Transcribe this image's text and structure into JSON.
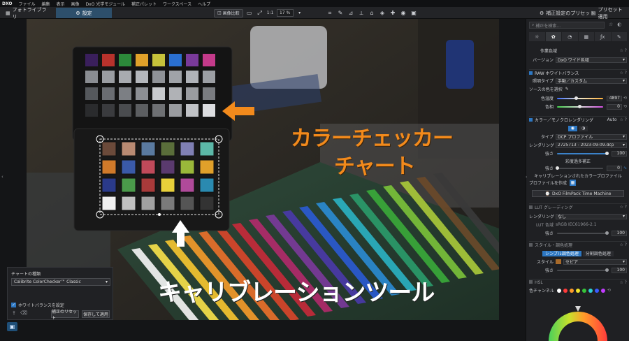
{
  "menu": {
    "logo": "DXO",
    "items": [
      "ファイル",
      "編集",
      "表示",
      "画像",
      "DxO 光学モジュール",
      "補正パレット",
      "ワークスペース",
      "ヘルプ"
    ]
  },
  "toolbar": {
    "library_tab": "フォトライブラリ",
    "settings_tab": "設定",
    "compare_label": "画像比較",
    "zoom_ratio": "1:1",
    "zoom_percent": "17 %",
    "presets_label": "補正設定のプリセット",
    "preview_label": "プリセット適用"
  },
  "overlay": {
    "line1": "カラーチェッカー",
    "line2": "チャート",
    "line3": "キャリブレーションツール"
  },
  "chart_panel": {
    "title": "チャートの種類",
    "selected": "Calibrite ColorChecker™ Classic",
    "whitebalance_label": "ホワイトバランスを設定",
    "reset_label": "補正のリセット",
    "save_label": "保存して適用"
  },
  "right_panel": {
    "search_placeholder": "補正を検索...",
    "working_color": {
      "title": "作業色域",
      "version_label": "バージョン",
      "version_value": "DxO ワイド色域"
    },
    "raw_wb": {
      "title": "RAW ホワイトバランス",
      "light_type_label": "照明タイプ",
      "light_type_value": "手動／カスタム",
      "picker_label": "ソースの色を選択",
      "temp_label": "色温度",
      "temp_value": "4897",
      "tint_label": "色相",
      "tint_value": "0"
    },
    "color_render": {
      "title": "カラー／モノクロレンダリング",
      "auto_label": "Auto",
      "type_label": "タイプ",
      "type_value": "DCP プロファイル",
      "rendering_label": "レンダリング",
      "rendering_value": "2725713 - 2023-09-09.dcp",
      "strength_label": "強さ",
      "strength_value": "100",
      "protect_label": "彩度過多補正",
      "protect_strength_label": "強さ",
      "protect_strength_value": "0",
      "calibrated_label": "キャリブレーションされたカラープロファイル",
      "create_profile_label": "プロファイルを作成",
      "filmpack_label": "DxO FilmPack Time Machine"
    },
    "lut": {
      "title": "LUT グレーディング",
      "rendering_label": "レンダリング",
      "rendering_value": "なし",
      "lut_space_label": "LUT 色域",
      "lut_space_value": "sRGB IEC61966-2.1",
      "strength_label": "強さ",
      "strength_value": "100"
    },
    "style": {
      "title": "スタイル・調色処理",
      "seg_simple": "シンプル調色処理",
      "seg_split": "分割調色処理",
      "style_label": "スタイル",
      "style_value": "セピア",
      "strength_label": "強さ",
      "strength_value": "100"
    },
    "hsl": {
      "title": "HSL",
      "channel_label": "色チャンネル"
    }
  },
  "colors": {
    "accent": "#2d77c2",
    "overlay_orange": "#f28a1c",
    "hsl_dots": [
      "#ffffff",
      "#ff3b3b",
      "#ff9b2a",
      "#f2e62c",
      "#36c43a",
      "#2fd0d6",
      "#3a5bff",
      "#c23cff"
    ]
  }
}
